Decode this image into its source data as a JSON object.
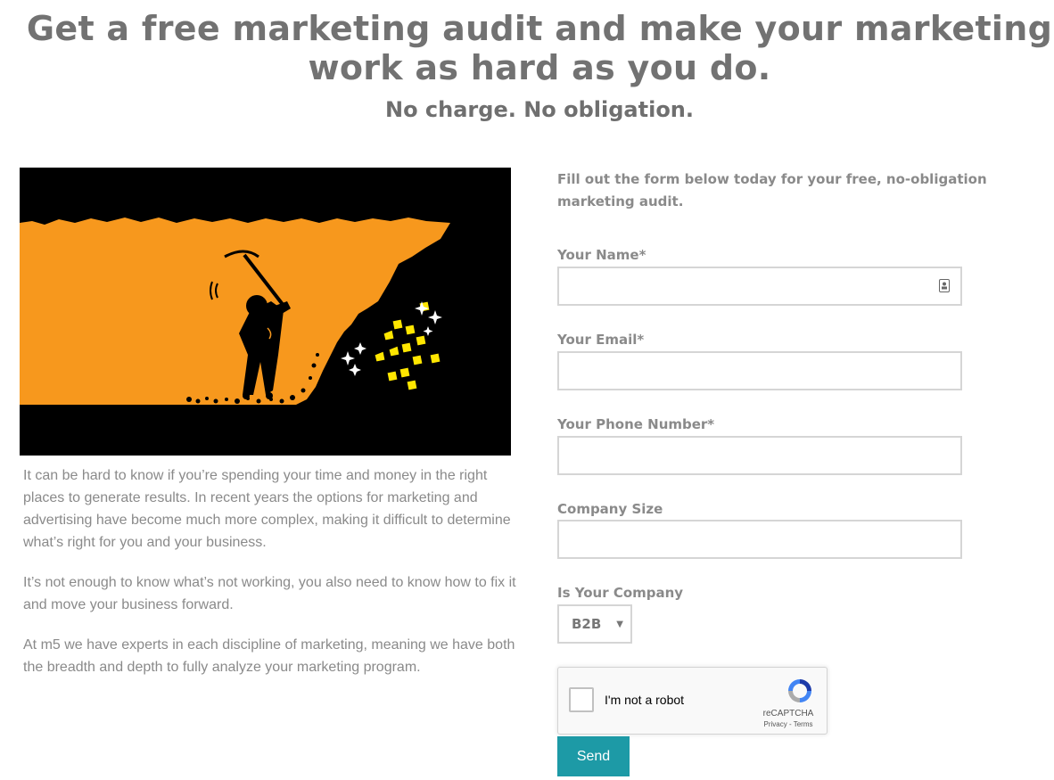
{
  "header": {
    "headline": "Get a free marketing audit and make your marketing work as hard as you do.",
    "subhead": "No charge. No obligation."
  },
  "body_copy": [
    "It can be hard to know if you’re spending your time and money in the right places to generate results. In recent years the options for marketing and advertising have become much more complex, making it difficult to determine what’s right for you and your business.",
    "It’s not enough to know what’s not working, you also need to know how to fix it and move your business forward.",
    "At m5 we have experts in each discipline of marketing, meaning we have both the breadth  and depth to fully analyze your marketing program."
  ],
  "form": {
    "intro": "Fill out the form below today for your free, no-obligation marketing audit.",
    "fields": [
      {
        "label": "Your Name*",
        "value": ""
      },
      {
        "label": "Your Email*",
        "value": ""
      },
      {
        "label": "Your Phone Number*",
        "value": ""
      },
      {
        "label": "Company Size",
        "value": ""
      }
    ],
    "company_type": {
      "label": "Is Your Company",
      "selected": "B2B"
    },
    "recaptcha": {
      "label": "I'm not a robot",
      "brand": "reCAPTCHA",
      "links": "Privacy - Terms"
    },
    "submit_label": "Send"
  },
  "colors": {
    "heading": "#727272",
    "body_text": "#8a8a8a",
    "button": "#1d9aa6",
    "hero_orange": "#f7981d",
    "gold": "#ffe600"
  }
}
